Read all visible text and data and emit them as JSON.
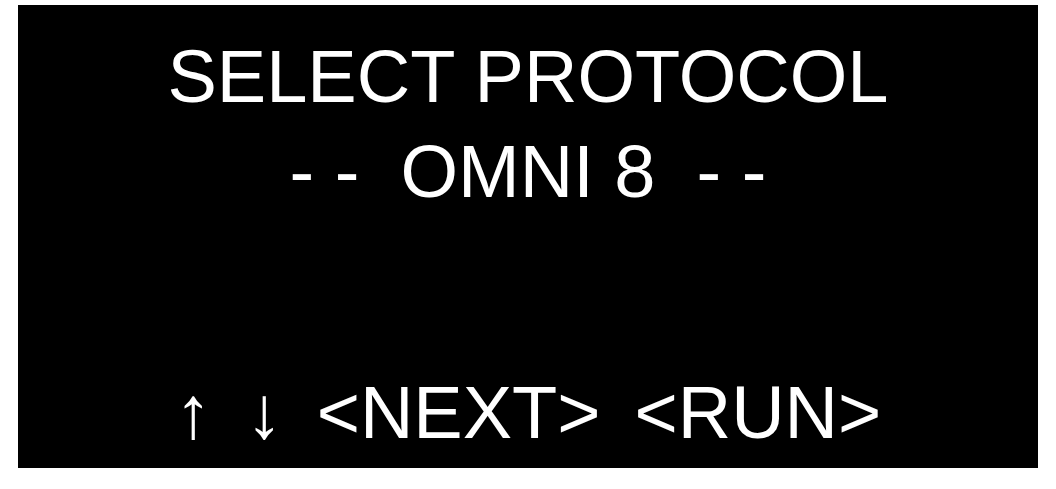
{
  "display": {
    "title": "SELECT PROTOCOL",
    "selection": "- -  OMNI 8  - -",
    "keys": [
      {
        "label": "↑"
      },
      {
        "label": "↓"
      },
      {
        "label": "<NEXT>"
      },
      {
        "label": "<RUN>"
      }
    ]
  }
}
